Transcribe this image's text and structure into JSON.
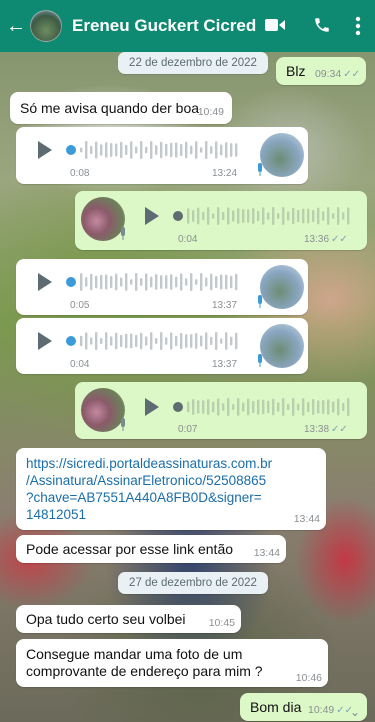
{
  "header": {
    "contact_name": "Ereneu Guckert Cicred",
    "back_icon": "arrow-left-icon",
    "video_icon": "video-call-icon",
    "call_icon": "phone-icon",
    "menu_icon": "more-vert-icon"
  },
  "messages": {
    "date1": "22 de dezembro de 2022",
    "m1": {
      "text": "Blz",
      "time": "09:34",
      "ticks": "✓✓"
    },
    "m2": {
      "text": "Só me avisa quando der boa",
      "time": "10:49"
    },
    "v1": {
      "elapsed": "0:08",
      "time": "13:24"
    },
    "v2": {
      "elapsed": "0:04",
      "time": "13:36",
      "ticks": "✓✓"
    },
    "v3": {
      "elapsed": "0:05",
      "time": "13:37"
    },
    "v4": {
      "elapsed": "0:04",
      "time": "13:37"
    },
    "v5": {
      "elapsed": "0:07",
      "time": "13:38",
      "ticks": "✓✓"
    },
    "link_msg": {
      "line1": "https://sicredi.portaldeassinaturas.com.br",
      "line2": "/Assinatura/AssinarEletronico/52508865",
      "line3": "?chave=AB7551A440A8FB0D&signer=",
      "line4": "14812051",
      "time": "13:44"
    },
    "m3": {
      "text": "Pode acessar por esse link então",
      "time": "13:44"
    },
    "date2": "27 de dezembro de 2022",
    "m4": {
      "text": "Opa tudo certo seu volbei",
      "time": "10:45"
    },
    "m5": {
      "line1": "Consegue mandar uma foto de um",
      "line2": "comprovante de endereço para mim ?",
      "time": "10:46"
    },
    "m6": {
      "text": "Bom dia",
      "time": "10:49",
      "ticks": "✓✓"
    }
  },
  "colors": {
    "header": "#0e8a72",
    "incoming": "#ffffff",
    "outgoing": "#dcf8c6",
    "link": "#1a6ea8",
    "played_dot": "#3a9bd8"
  }
}
